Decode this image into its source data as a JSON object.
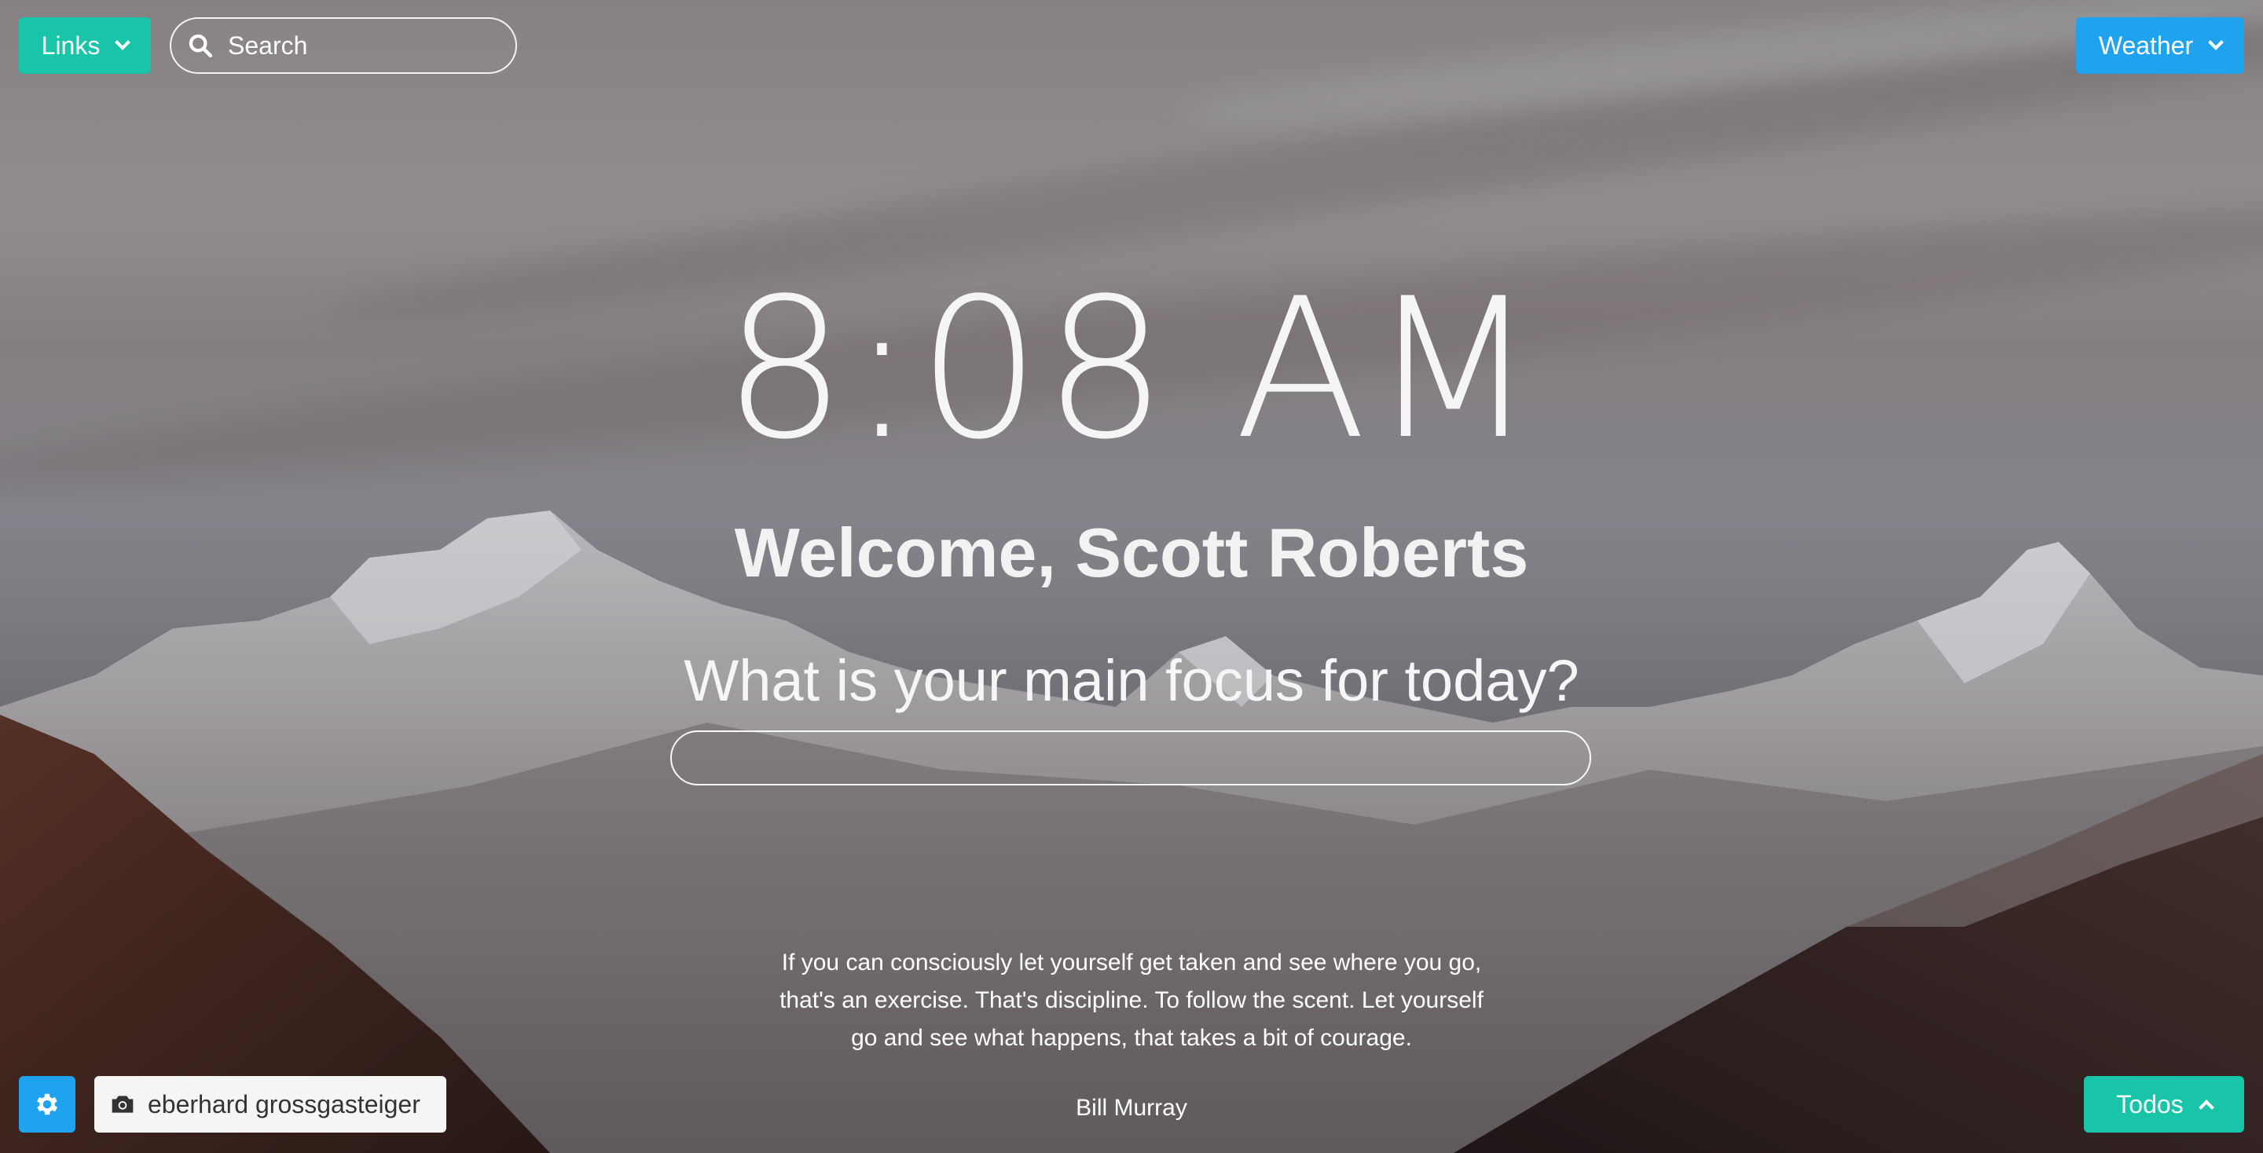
{
  "topbar": {
    "links_label": "Links",
    "search_placeholder": "Search",
    "weather_label": "Weather"
  },
  "main": {
    "time": "8:08 AM",
    "welcome": "Welcome, Scott Roberts",
    "focus_question": "What is your main focus for today?",
    "focus_value": ""
  },
  "quote": {
    "text": "If you can consciously let yourself get taken and see where you go, that's an exercise. That's discipline. To follow the scent. Let yourself go and see what happens, that takes a bit of courage.",
    "author": "Bill Murray"
  },
  "footer": {
    "photo_credit": "eberhard grossgasteiger",
    "todos_label": "Todos"
  },
  "colors": {
    "teal": "#18c5a8",
    "blue": "#1fa3ee"
  },
  "icons": {
    "links_chevron": "chevron-down-icon",
    "weather_chevron": "chevron-down-icon",
    "todos_chevron": "chevron-up-icon",
    "search": "search-icon",
    "settings": "gear-icon",
    "camera": "camera-icon"
  }
}
